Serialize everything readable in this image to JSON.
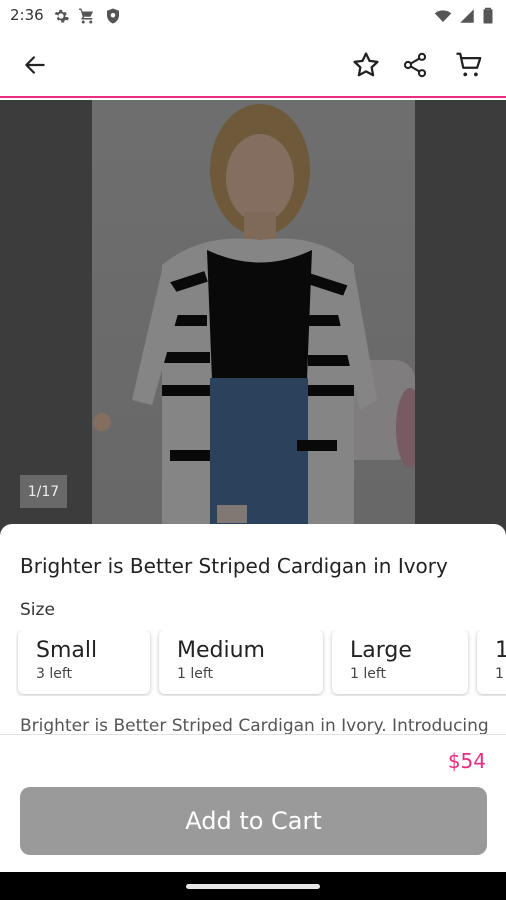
{
  "status_bar": {
    "time": "2:36",
    "icons_left": [
      "gear-icon",
      "cart-icon",
      "shield-icon"
    ],
    "icons_right": [
      "wifi-icon",
      "signal-icon",
      "battery-icon"
    ]
  },
  "app_bar": {
    "icons": [
      "back-arrow-icon",
      "star-icon",
      "share-icon",
      "cart-icon"
    ],
    "accent_color": "#ec2a7f"
  },
  "gallery": {
    "counter": "1/17"
  },
  "product": {
    "title": "Brighter is Better Striped Cardigan in Ivory",
    "size_label": "Size",
    "sizes": [
      {
        "name": "Small",
        "stock": "3 left"
      },
      {
        "name": "Medium",
        "stock": "1 left"
      },
      {
        "name": "Large",
        "stock": "1 left"
      },
      {
        "name": "1",
        "stock": "1"
      }
    ],
    "description": "Brighter is Better Striped Cardigan in Ivory. Introducing",
    "price": "$54",
    "price_color": "#ec2a7f",
    "add_to_cart_label": "Add to Cart"
  }
}
